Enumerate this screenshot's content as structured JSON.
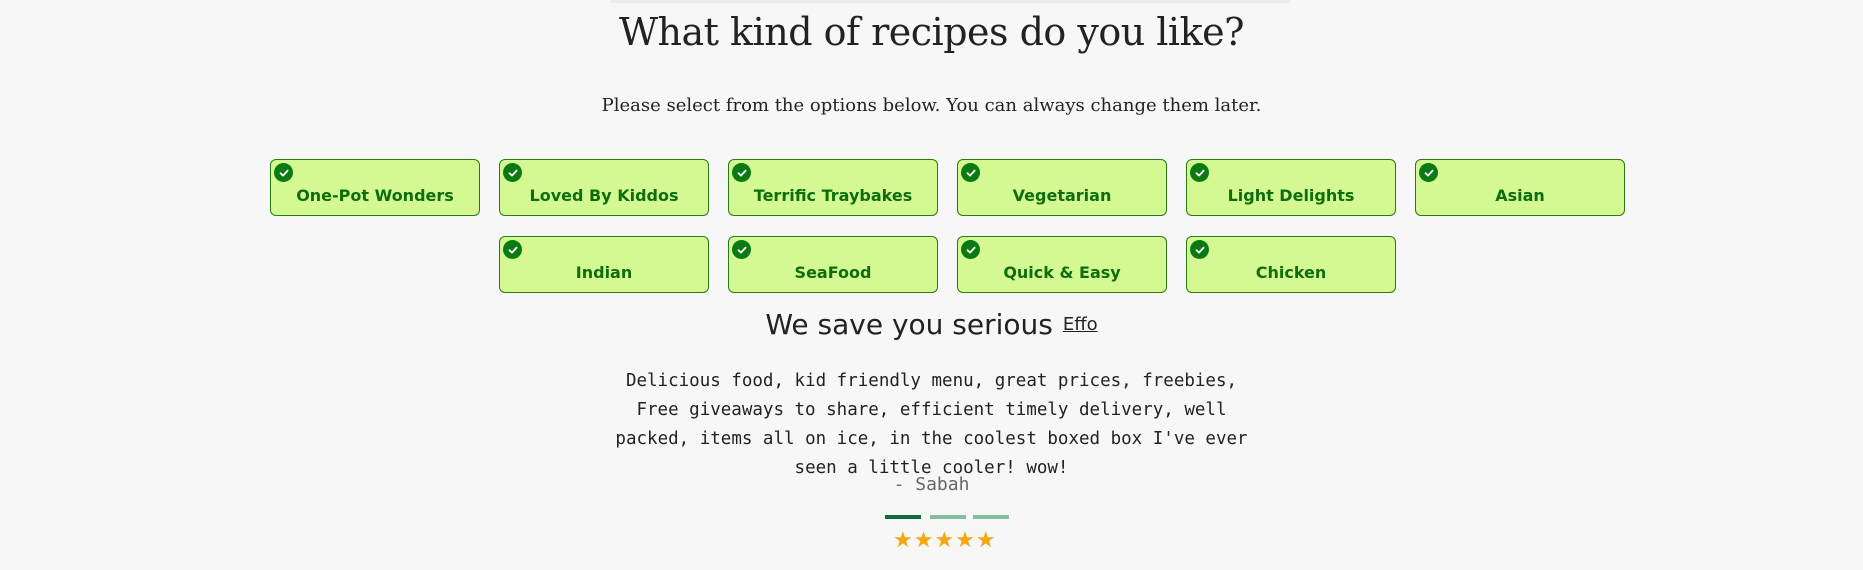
{
  "header": {
    "title": "What kind of recipes do you like?",
    "subtitle": "Please select from the options below. You can always change them later."
  },
  "categories": [
    {
      "label": "One-Pot Wonders",
      "selected": true
    },
    {
      "label": "Loved By Kiddos",
      "selected": true
    },
    {
      "label": "Terrific Traybakes",
      "selected": true
    },
    {
      "label": "Vegetarian",
      "selected": true
    },
    {
      "label": "Light Delights",
      "selected": true
    },
    {
      "label": "Asian",
      "selected": true
    },
    {
      "label": "Indian",
      "selected": true
    },
    {
      "label": "SeaFood",
      "selected": true
    },
    {
      "label": "Quick & Easy",
      "selected": true
    },
    {
      "label": "Chicken",
      "selected": true
    }
  ],
  "review": {
    "heading": "We save you serious",
    "link_text": "Effo",
    "quote": "Delicious food, kid friendly menu, great prices, freebies, Free giveaways to share, efficient timely delivery, well packed, items all on ice, in the coolest boxed box I've ever seen a little cooler! wow!",
    "author": "- Sabah",
    "slide_count": 3,
    "active_slide": 1,
    "rating": 5,
    "stars": "★★★★★"
  },
  "colors": {
    "chip_bg": "#d4f993",
    "chip_border": "#2a7a10",
    "chip_text": "#0d6e0b",
    "check_bg": "#0b7a13",
    "star": "#f3a712",
    "dot_active": "#0d6b3e",
    "dot_inactive": "#7fbfa0"
  }
}
